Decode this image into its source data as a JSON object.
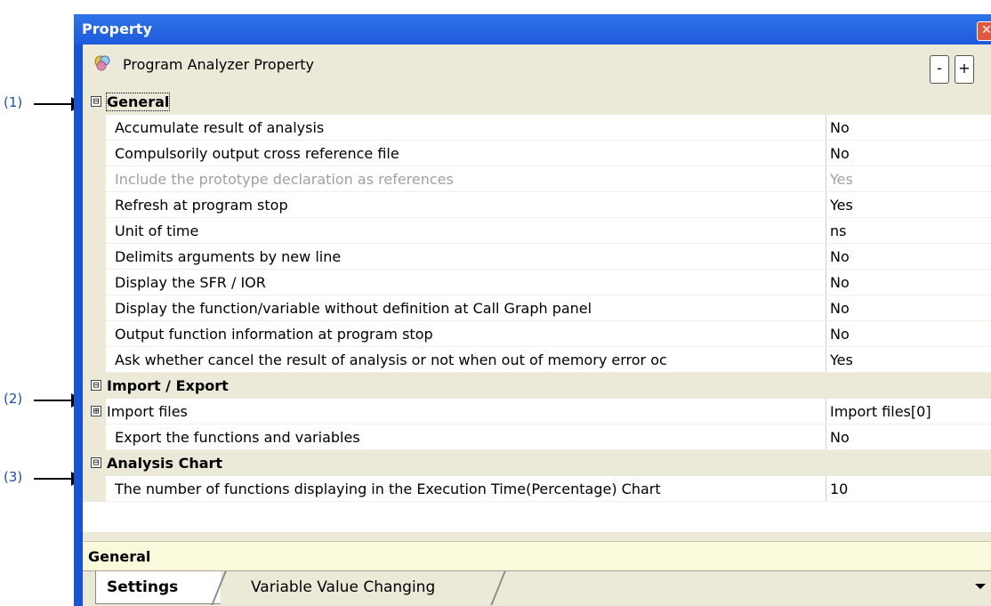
{
  "callouts": [
    "(1)",
    "(2)",
    "(3)"
  ],
  "window": {
    "title": "Property",
    "close_glyph": "✕"
  },
  "header": {
    "icon": "program-analyzer-icon",
    "title": "Program Analyzer Property",
    "collapse_label": "-",
    "expand_label": "+"
  },
  "categories": {
    "general": {
      "toggle": "⊟",
      "label": "General"
    },
    "import_export": {
      "toggle": "⊟",
      "label": "Import / Export"
    },
    "analysis_chart": {
      "toggle": "⊟",
      "label": "Analysis Chart"
    }
  },
  "general_rows": [
    {
      "name": "Accumulate result of analysis",
      "value": "No"
    },
    {
      "name": "Compulsorily output cross reference file",
      "value": "No"
    },
    {
      "name": "Include the prototype declaration as references",
      "value": "Yes",
      "disabled": true
    },
    {
      "name": "Refresh at program stop",
      "value": "Yes"
    },
    {
      "name": "Unit of time",
      "value": "ns"
    },
    {
      "name": "Delimits arguments by new line",
      "value": "No"
    },
    {
      "name": "Display the SFR / IOR",
      "value": "No"
    },
    {
      "name": "Display the function/variable without definition at Call Graph panel",
      "value": "No"
    },
    {
      "name": "Output function information at program stop",
      "value": "No"
    },
    {
      "name": "Ask whether cancel the result of analysis or not when out of memory error oc",
      "value": "Yes"
    }
  ],
  "import_export_rows": [
    {
      "name": "Import files",
      "value": "Import files[0]",
      "toggle": "⊞"
    },
    {
      "name": "Export the functions and variables",
      "value": "No"
    }
  ],
  "analysis_chart_rows": [
    {
      "name": "The number of functions displaying in the Execution Time(Percentage) Chart",
      "value": "10"
    }
  ],
  "description": "General",
  "tabs": {
    "settings": "Settings",
    "variable_value_changing": "Variable Value Changing"
  },
  "colors": {
    "title_bar": "#1e5bdc",
    "panel_bg": "#ece9d8",
    "description_bg": "#fbf9dc",
    "callout_text": "#1f4ea8"
  }
}
